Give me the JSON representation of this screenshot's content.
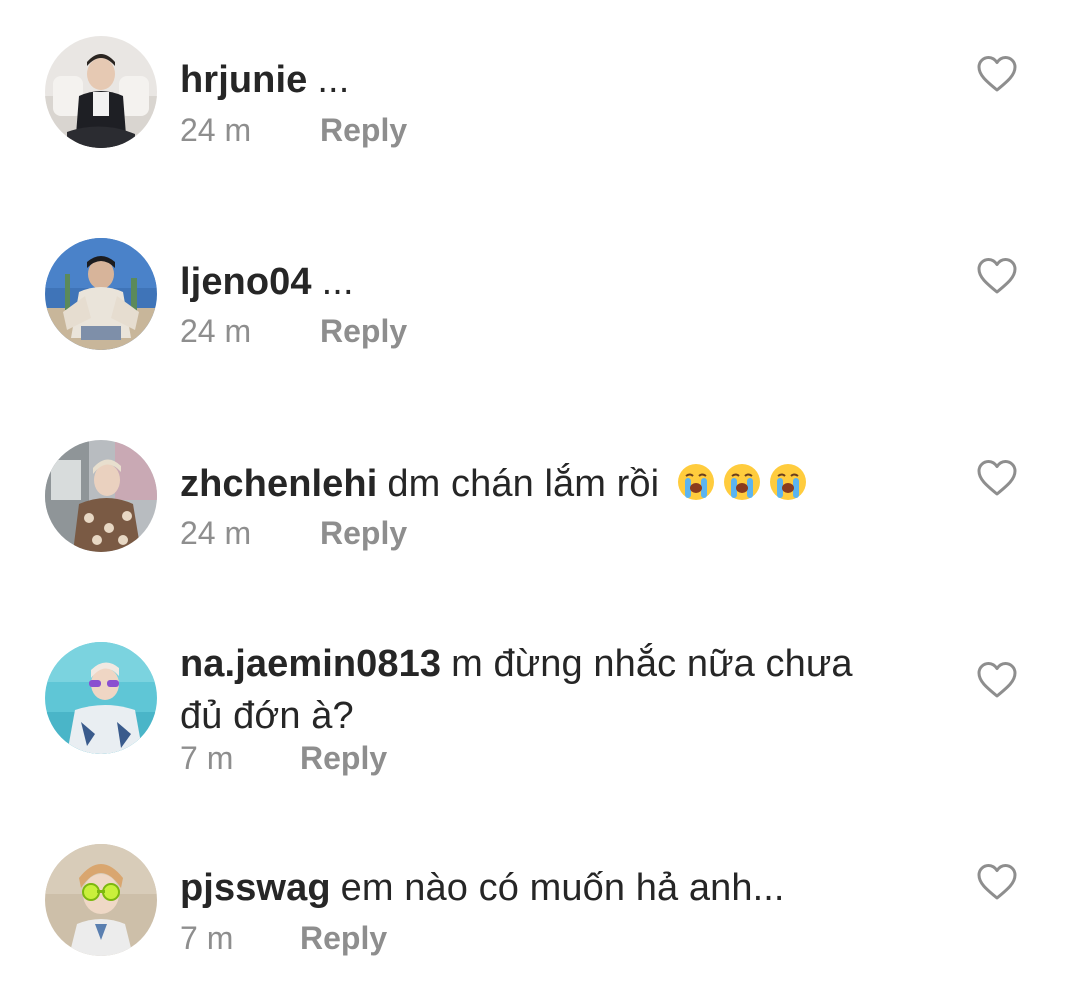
{
  "comments": [
    {
      "username": "hrjunie",
      "text": "...",
      "time": "24 m",
      "reply_label": "Reply",
      "avatar": "profile-photo"
    },
    {
      "username": "ljeno04",
      "text": "...",
      "time": "24 m",
      "reply_label": "Reply",
      "avatar": "profile-photo"
    },
    {
      "username": "zhchenlehi",
      "text": "dm chán lắm rồi",
      "emojis": [
        "loudly-crying-face",
        "loudly-crying-face",
        "loudly-crying-face"
      ],
      "time": "24 m",
      "reply_label": "Reply",
      "avatar": "profile-photo"
    },
    {
      "username": "na.jaemin0813",
      "text": "m đừng nhắc nữa chưa đủ đớn à?",
      "time": "7 m",
      "reply_label": "Reply",
      "avatar": "profile-photo"
    },
    {
      "username": "pjsswag",
      "text": "em nào có muốn hả anh...",
      "time": "7 m",
      "reply_label": "Reply",
      "avatar": "profile-photo"
    }
  ],
  "icons": {
    "like": "heart-outline-icon",
    "emoji": "loudly-crying-face"
  },
  "colors": {
    "text": "#262626",
    "secondary": "#8e8e8e",
    "icon": "#8e8e8e",
    "background": "#ffffff"
  }
}
